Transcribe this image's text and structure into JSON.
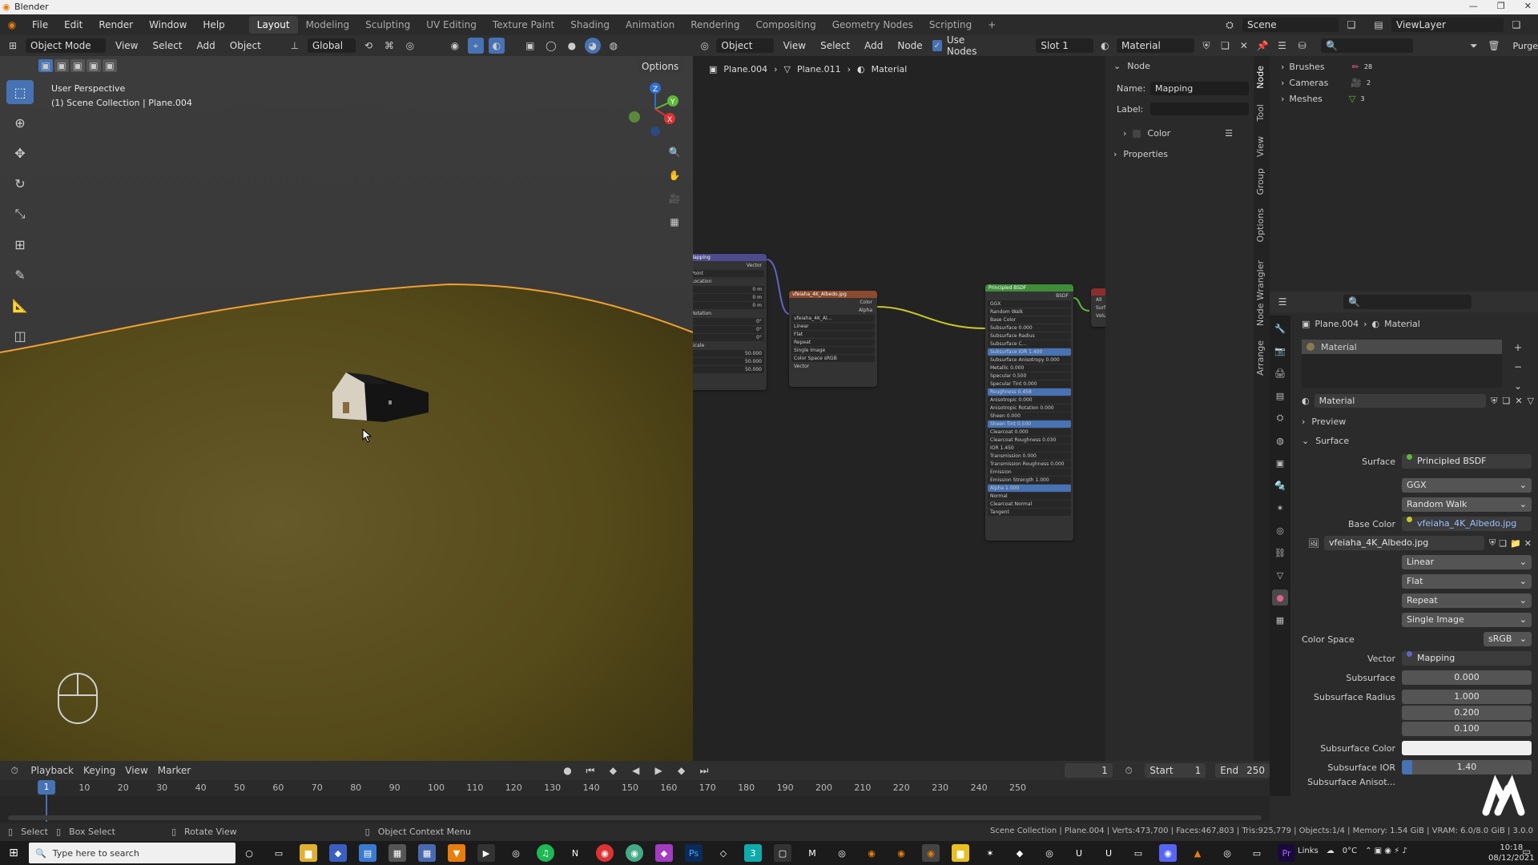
{
  "window": {
    "title": "Blender",
    "controls": [
      "—",
      "❐",
      "✕"
    ]
  },
  "menu": [
    "File",
    "Edit",
    "Render",
    "Window",
    "Help"
  ],
  "workspaces": [
    "Layout",
    "Modeling",
    "Sculpting",
    "UV Editing",
    "Texture Paint",
    "Shading",
    "Animation",
    "Rendering",
    "Compositing",
    "Geometry Nodes",
    "Scripting"
  ],
  "workspace_add": "+",
  "scene": {
    "scene_name": "Scene",
    "view_layer": "ViewLayer"
  },
  "viewport": {
    "mode": "Object Mode",
    "menus": [
      "View",
      "Select",
      "Add",
      "Object"
    ],
    "orientation": "Global",
    "options": "Options",
    "info_line1": "User Perspective",
    "info_line2": "(1) Scene Collection | Plane.004",
    "gizmo_axes": {
      "z": "Z",
      "y": "Y",
      "x": "X"
    }
  },
  "node_editor": {
    "type": "Object",
    "menus": [
      "View",
      "Select",
      "Add",
      "Node"
    ],
    "use_nodes_label": "Use Nodes",
    "slot": "Slot 1",
    "material": "Material",
    "breadcrumb": [
      "Plane.004",
      "Plane.011",
      "Material"
    ],
    "nodes": {
      "mapping_title": "Mapping",
      "mapping_rows": [
        "Vector",
        "Point",
        "Location",
        "0 m",
        "0 m",
        "0 m",
        "Rotation",
        "0°",
        "0°",
        "0°",
        "Scale",
        "50.000",
        "50.000",
        "50.000"
      ],
      "image_title": "vfeiaha_4K_Albedo.jpg",
      "image_rows": [
        "Color",
        "Alpha",
        "vfeiaha_4K_Al...",
        "Linear",
        "Flat",
        "Repeat",
        "Single Image",
        "Color Space   sRGB",
        "Vector"
      ],
      "bsdf_title": "Principled BSDF",
      "bsdf_rows": [
        "BSDF",
        "GGX",
        "Random Walk",
        "Base Color",
        "Subsurface  0.000",
        "Subsurface Radius",
        "Subsurface C...",
        "Subsurface IOR  1.400",
        "Subsurface Anisotropy  0.000",
        "Metallic  0.000",
        "Specular  0.500",
        "Specular Tint  0.000",
        "Roughness  0.458",
        "Anisotropic  0.000",
        "Anisotropic Rotation  0.000",
        "Sheen  0.000",
        "Sheen Tint  0.500",
        "Clearcoat  0.000",
        "Clearcoat Roughness  0.030",
        "IOR  1.450",
        "Transmission  0.000",
        "Transmission Roughness  0.000",
        "Emission",
        "Emission Strength  1.000",
        "Alpha  1.000",
        "Normal",
        "Clearcoat Normal",
        "Tangent"
      ],
      "output_rows": [
        "All",
        "Surface",
        "Volume",
        "Displacement"
      ]
    }
  },
  "node_sidebar": {
    "panel": "Node",
    "name_label": "Name:",
    "name_value": "Mapping",
    "label_label": "Label:",
    "label_value": "",
    "color": "Color",
    "properties": "Properties",
    "tabs": [
      "Node",
      "Tool",
      "View",
      "Group",
      "Options",
      "Node Wrangler",
      "Arrange"
    ]
  },
  "outliner": {
    "items": [
      {
        "label": "Brushes",
        "count": "28"
      },
      {
        "label": "Cameras",
        "count": "2"
      },
      {
        "label": "Meshes",
        "count": "3"
      }
    ],
    "purge": "Purge"
  },
  "properties": {
    "breadcrumb": [
      "Plane.004",
      "Material"
    ],
    "slot_name": "Material",
    "material_name": "Material",
    "preview": "Preview",
    "surface_panel": "Surface",
    "rows": {
      "surface_label": "Surface",
      "surface_value": "Principled BSDF",
      "distribution": "GGX",
      "subsurface_method": "Random Walk",
      "base_color_label": "Base Color",
      "base_color_value": "vfeiaha_4K_Albedo.jpg",
      "image_name": "vfeiaha_4K_Albedo.jpg",
      "interpolation": "Linear",
      "projection": "Flat",
      "extension": "Repeat",
      "source": "Single Image",
      "color_space_label": "Color Space",
      "color_space_value": "sRGB",
      "vector_label": "Vector",
      "vector_value": "Mapping",
      "subsurface_label": "Subsurface",
      "subsurface_value": "0.000",
      "subsurface_radius_label": "Subsurface Radius",
      "subsurface_radius_1": "1.000",
      "subsurface_radius_2": "0.200",
      "subsurface_radius_3": "0.100",
      "subsurface_color_label": "Subsurface Color",
      "subsurface_ior_label": "Subsurface IOR",
      "subsurface_ior_value": "1.40",
      "subsurface_aniso_label": "Subsurface Anisot..."
    }
  },
  "timeline": {
    "menus": [
      "Playback",
      "Keying",
      "View",
      "Marker"
    ],
    "current_frame": "1",
    "start_label": "Start",
    "start": "1",
    "end_label": "End",
    "end": "250",
    "ticks": [
      "10",
      "20",
      "30",
      "40",
      "50",
      "60",
      "70",
      "80",
      "90",
      "100",
      "110",
      "120",
      "130",
      "140",
      "150",
      "160",
      "170",
      "180",
      "190",
      "200",
      "210",
      "220",
      "230",
      "240",
      "250"
    ],
    "playhead": "1"
  },
  "statusbar": {
    "select": "Select",
    "box_select": "Box Select",
    "rotate": "Rotate View",
    "context": "Object Context Menu",
    "stats": "Scene Collection | Plane.004 | Verts:473,700 | Faces:467,803 | Tris:925,779 | Objects:1/4 | Memory: 1.54 GiB | VRAM: 6.0/8.0 GiB | 3.0.0"
  },
  "taskbar": {
    "search_placeholder": "Type here to search",
    "links": "Links",
    "weather": "0°C",
    "time": "10:18",
    "date": "08/12/2021"
  },
  "colors": {
    "accent": "#4772b3",
    "mapping_header": "#4e4b8c",
    "image_header": "#8c4b2e",
    "bsdf_header": "#3f8c3a",
    "grass": "#5a4f1f",
    "selection_outline": "#f0a030"
  }
}
